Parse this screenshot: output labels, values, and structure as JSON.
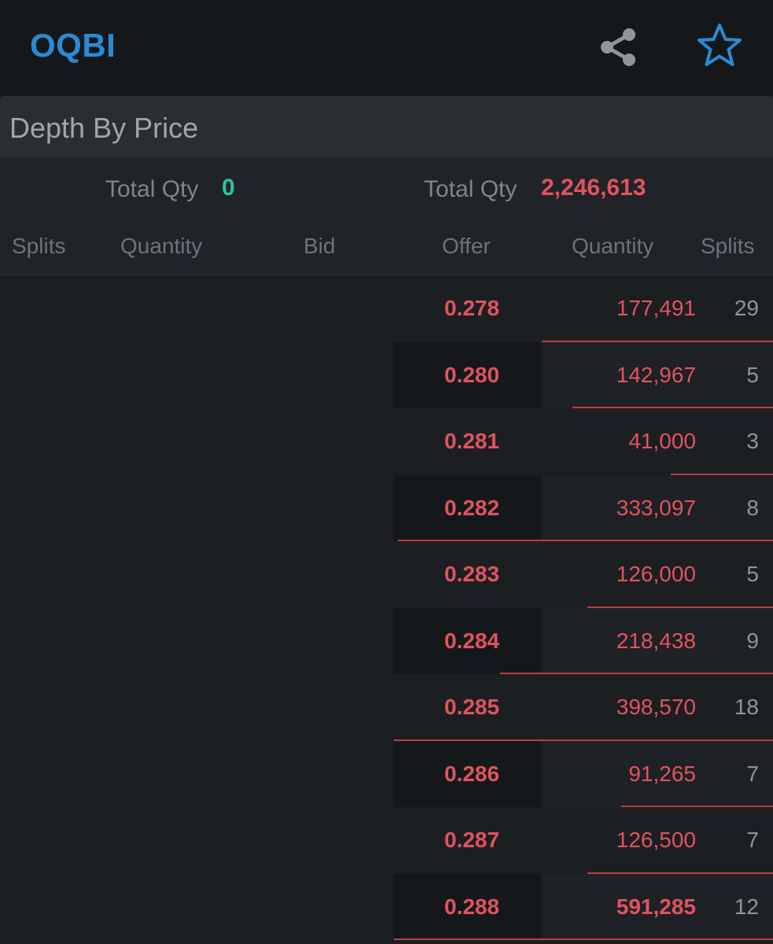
{
  "header": {
    "title": "OQBI",
    "share_icon": "share-icon",
    "favorite_icon": "star-outline-icon",
    "accent_color": "#2a8bd4"
  },
  "section": {
    "title": "Depth By Price"
  },
  "totals": {
    "bid_label": "Total Qty",
    "bid_value": "0",
    "bid_color": "#2ec4a0",
    "offer_label": "Total Qty",
    "offer_value": "2,246,613",
    "offer_color": "#e0535f"
  },
  "columns": {
    "bid_splits": "Splits",
    "bid_quantity": "Quantity",
    "bid": "Bid",
    "offer": "Offer",
    "offer_quantity": "Quantity",
    "offer_splits": "Splits"
  },
  "offers": [
    {
      "price": "0.278",
      "quantity": "177,491",
      "splits": "29",
      "depth_fraction": 0.61
    },
    {
      "price": "0.280",
      "quantity": "142,967",
      "splits": "5",
      "depth_fraction": 0.53
    },
    {
      "price": "0.281",
      "quantity": "41,000",
      "splits": "3",
      "depth_fraction": 0.27
    },
    {
      "price": "0.282",
      "quantity": "333,097",
      "splits": "8",
      "depth_fraction": 0.99
    },
    {
      "price": "0.283",
      "quantity": "126,000",
      "splits": "5",
      "depth_fraction": 0.49
    },
    {
      "price": "0.284",
      "quantity": "218,438",
      "splits": "9",
      "depth_fraction": 0.72
    },
    {
      "price": "0.285",
      "quantity": "398,570",
      "splits": "18",
      "depth_fraction": 1.0
    },
    {
      "price": "0.286",
      "quantity": "91,265",
      "splits": "7",
      "depth_fraction": 0.4
    },
    {
      "price": "0.287",
      "quantity": "126,500",
      "splits": "7",
      "depth_fraction": 0.49
    },
    {
      "price": "0.288",
      "quantity": "591,285",
      "splits": "12",
      "depth_fraction": 1.0
    }
  ],
  "bids": []
}
